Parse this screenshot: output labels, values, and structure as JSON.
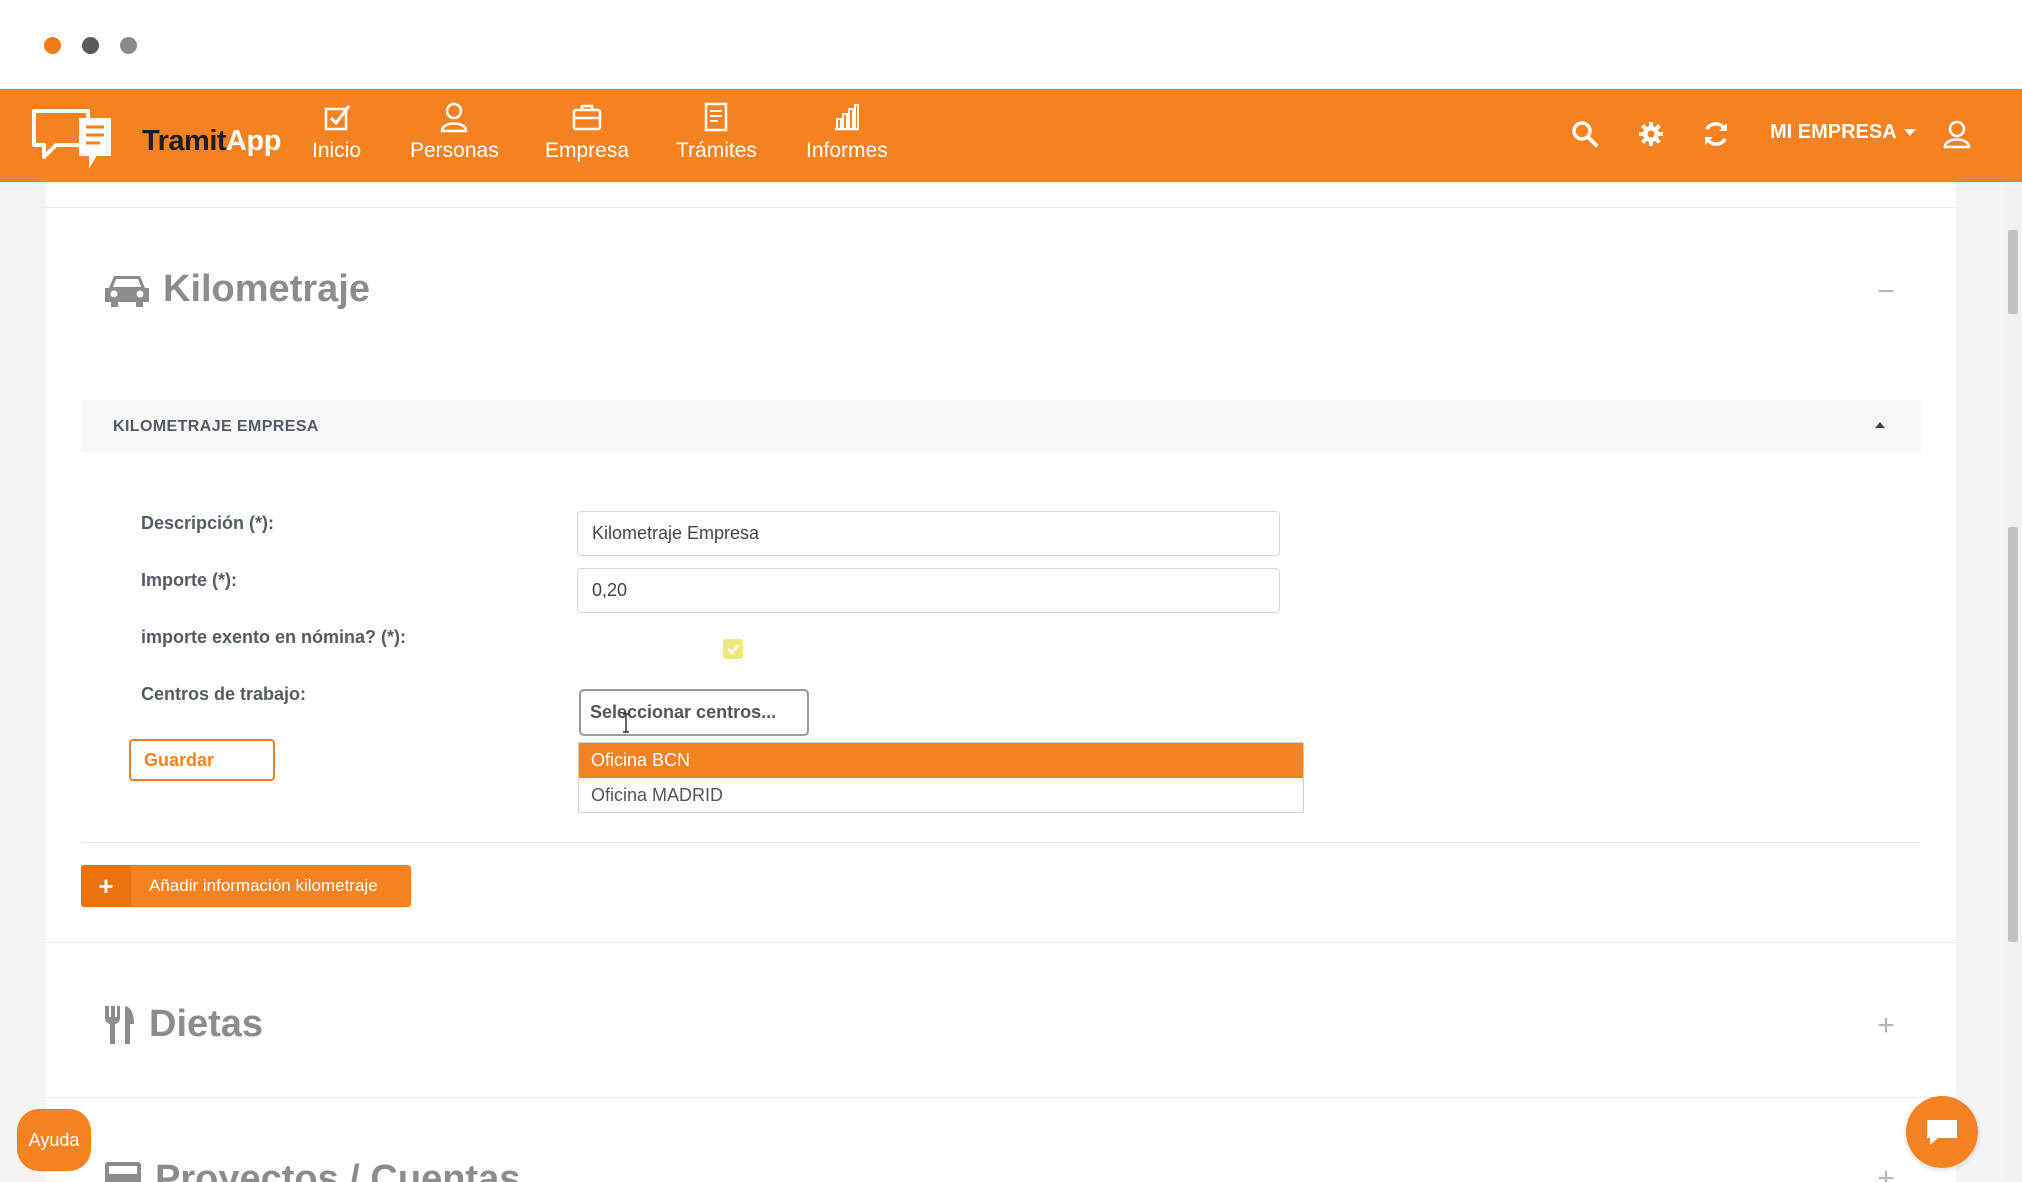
{
  "brand": {
    "name_part1": "Tramit",
    "name_part2": "App",
    "color": "#f58220"
  },
  "nav": {
    "items": [
      {
        "label": "Inicio",
        "icon": "checkbox-icon"
      },
      {
        "label": "Personas",
        "icon": "person-icon"
      },
      {
        "label": "Empresa",
        "icon": "briefcase-icon"
      },
      {
        "label": "Trámites",
        "icon": "document-icon"
      },
      {
        "label": "Informes",
        "icon": "bar-chart-icon"
      }
    ],
    "company": "MI EMPRESA"
  },
  "kilometraje": {
    "title": "Kilometraje",
    "toggle": "−",
    "subsection": {
      "title": "KILOMETRAJE EMPRESA",
      "fields": {
        "descripcion_label": "Descripción (*):",
        "descripcion_value": "Kilometraje Empresa",
        "importe_label": "Importe (*):",
        "importe_value": "0,20",
        "exento_label": "importe exento en nómina? (*):",
        "exento_checked": true,
        "centros_label": "Centros de trabajo:",
        "centros_placeholder": "Seleccionar centros..."
      },
      "dropdown_options": [
        "Oficina BCN",
        "Oficina MADRID"
      ],
      "save_label": "Guardar"
    },
    "add_label": "Añadir información kilometraje",
    "add_icon": "+"
  },
  "dietas": {
    "title": "Dietas",
    "toggle": "+"
  },
  "proyectos": {
    "title": "Proyectos / Cuentas",
    "toggle": "+"
  },
  "help_label": "Ayuda"
}
